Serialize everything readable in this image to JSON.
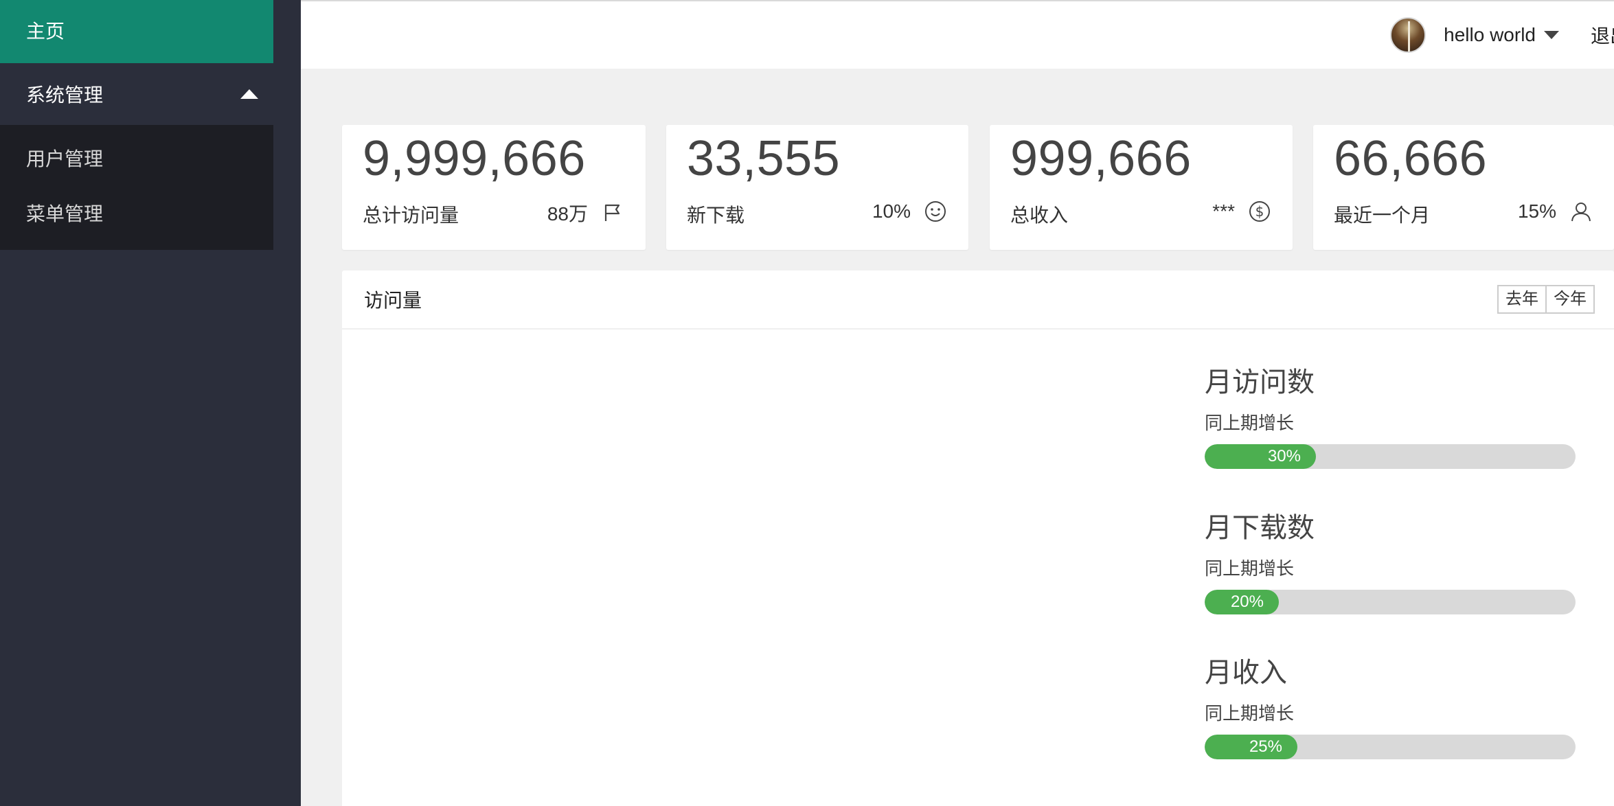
{
  "sidebar": {
    "home_label": "主页",
    "group_label": "系统管理",
    "sub_items": [
      {
        "label": "用户管理"
      },
      {
        "label": "菜单管理"
      }
    ]
  },
  "header": {
    "username": "hello world",
    "logout_label": "退出"
  },
  "stats": [
    {
      "value": "9,999,666",
      "label": "总计访问量",
      "side": "88万",
      "icon": "flag-icon"
    },
    {
      "value": "33,555",
      "label": "新下载",
      "side": "10%",
      "icon": "smile-icon"
    },
    {
      "value": "999,666",
      "label": "总收入",
      "side": "***",
      "icon": "dollar-icon"
    },
    {
      "value": "66,666",
      "label": "最近一个月",
      "side": "15%",
      "icon": "user-icon"
    }
  ],
  "panel": {
    "title": "访问量",
    "buttons": [
      "去年",
      "今年"
    ]
  },
  "metrics": [
    {
      "title": "月访问数",
      "subtitle": "同上期增长",
      "percent_label": "30%",
      "fraction": 0.3
    },
    {
      "title": "月下载数",
      "subtitle": "同上期增长",
      "percent_label": "20%",
      "fraction": 0.2
    },
    {
      "title": "月收入",
      "subtitle": "同上期增长",
      "percent_label": "25%",
      "fraction": 0.25
    }
  ],
  "colors": {
    "accent": "#128870",
    "sidebar_bg": "#2b2e3b",
    "submenu_bg": "#1d1e24",
    "progress_fill": "#4caf50",
    "progress_track": "#d9d9d9"
  }
}
